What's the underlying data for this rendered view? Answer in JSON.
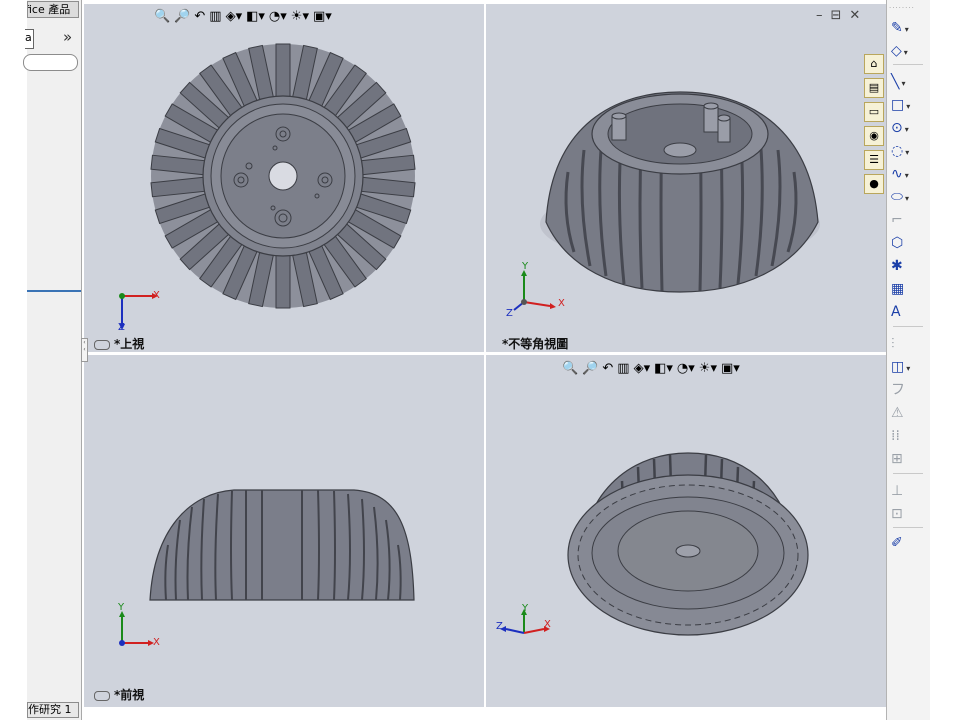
{
  "left_panel": {
    "tab_label": "fice 產品",
    "small_tab": "a",
    "chevron": "»",
    "status_tab": "作研究 1"
  },
  "viewports": {
    "top_left": {
      "label": "*上視"
    },
    "top_right": {
      "label": "*不等角視圖"
    },
    "bottom_left": {
      "label": "*前視"
    },
    "bottom_right": {
      "label": ""
    }
  },
  "axes": {
    "x": "X",
    "y": "Y",
    "z": "Z"
  },
  "view_toolbar_icons": [
    "zoom-to-fit-icon",
    "zoom-area-icon",
    "previous-view-icon",
    "section-view-icon",
    "view-orientation-icon",
    "display-style-icon",
    "hide-show-icon",
    "lights-icon",
    "scene-icon"
  ],
  "window_controls": {
    "minimize": "–",
    "restore": "⊟",
    "close": "✕"
  },
  "task_pane_icons": [
    "home-icon",
    "resources-icon",
    "folder-icon",
    "view-palette-icon",
    "properties-icon",
    "appearance-icon"
  ],
  "sketch_tools": [
    "smart-dimension-icon",
    "sketch-icon",
    "line-icon",
    "rectangle-icon",
    "circle-icon",
    "arc-icon",
    "spline-icon",
    "ellipse-icon",
    "fillet-icon",
    "polygon-icon",
    "point-icon",
    "centerline-grid-icon",
    "text-icon",
    "mirror-icon",
    "offset-icon",
    "convert-icon",
    "trim-icon",
    "linear-pattern-icon",
    "move-icon",
    "relations-icon",
    "repair-icon",
    "quick-snaps-icon"
  ],
  "colors": {
    "viewport_bg": "#cfd3dc",
    "part": "#7b7e8a",
    "axis_x": "#d12020",
    "axis_y": "#1a8a1a",
    "axis_z": "#1c2fbf"
  }
}
